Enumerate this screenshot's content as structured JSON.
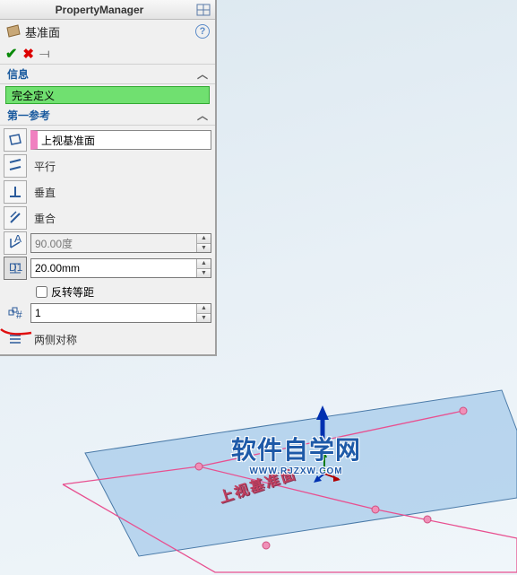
{
  "pm": {
    "title": "PropertyManager",
    "feature_name": "基准面",
    "info_header": "信息",
    "status_text": "完全定义",
    "first_ref_header": "第一参考",
    "selected_face": "上视基准面",
    "parallel_label": "平行",
    "perpendicular_label": "垂直",
    "coincident_label": "重合",
    "angle_value": "90.00度",
    "distance_value": "20.00mm",
    "flip_offset_label": "反转等距",
    "instances_value": "1",
    "mid_plane_label": "两侧对称"
  },
  "scene": {
    "plane_label": "上视基准面"
  },
  "watermark": {
    "main": "软件自学网",
    "sub": "WWW.RJZXW.COM"
  }
}
